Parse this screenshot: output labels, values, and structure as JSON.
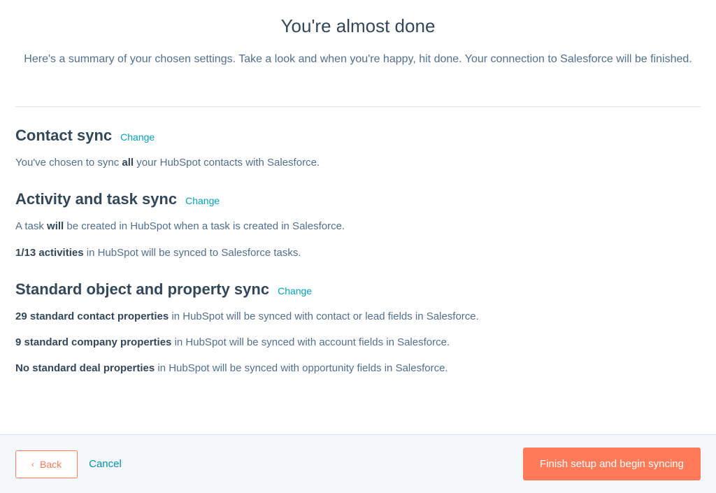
{
  "header": {
    "title": "You're almost done",
    "subtitle": "Here's a summary of your chosen settings. Take a look and when you're happy, hit done. Your connection to Salesforce will be finished."
  },
  "sections": {
    "contact": {
      "heading": "Contact sync",
      "change_label": "Change",
      "line1_pre": "You've chosen to sync ",
      "line1_bold": "all",
      "line1_post": " your HubSpot contacts with Salesforce."
    },
    "activity": {
      "heading": "Activity and task sync",
      "change_label": "Change",
      "line1_pre": "A task ",
      "line1_bold": "will",
      "line1_post": " be created in HubSpot when a task is created in Salesforce.",
      "line2_bold": "1/13 activities",
      "line2_post": " in HubSpot will be synced to Salesforce tasks."
    },
    "property": {
      "heading": "Standard object and property sync",
      "change_label": "Change",
      "line1_bold": "29 standard contact properties",
      "line1_post": " in HubSpot will be synced with contact or lead fields in Salesforce.",
      "line2_bold": "9 standard company properties",
      "line2_post": " in HubSpot will be synced with account fields in Salesforce.",
      "line3_bold": "No standard deal properties",
      "line3_post": " in HubSpot will be synced with opportunity fields in Salesforce."
    }
  },
  "footer": {
    "back_label": "Back",
    "cancel_label": "Cancel",
    "primary_label": "Finish setup and begin syncing"
  }
}
